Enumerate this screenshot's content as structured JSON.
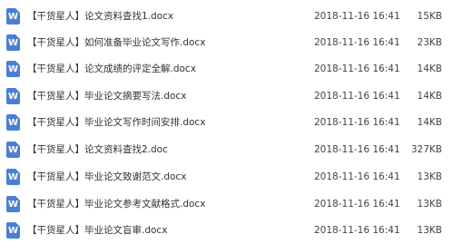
{
  "colors": {
    "word_icon": "#4a7fd6",
    "text": "#333333"
  },
  "icon": {
    "name": "word-doc-icon",
    "glyph": "W"
  },
  "files": [
    {
      "name": "【干货星人】论文资料查找1.docx",
      "modified": "2018-11-16 16:41",
      "size": "15KB"
    },
    {
      "name": "【干货星人】如何准备毕业论文写作.docx",
      "modified": "2018-11-16 16:41",
      "size": "23KB"
    },
    {
      "name": "【干货星人】论文成绩的评定全解.docx",
      "modified": "2018-11-16 16:41",
      "size": "14KB"
    },
    {
      "name": "【干货星人】毕业论文摘要写法.docx",
      "modified": "2018-11-16 16:41",
      "size": "14KB"
    },
    {
      "name": "【干货星人】毕业论文写作时间安排.docx",
      "modified": "2018-11-16 16:41",
      "size": "14KB"
    },
    {
      "name": "【干货星人】论文资料查找2.doc",
      "modified": "2018-11-16 16:41",
      "size": "327KB"
    },
    {
      "name": "【干货星人】毕业论文致谢范文.docx",
      "modified": "2018-11-16 16:41",
      "size": "13KB"
    },
    {
      "name": "【干货星人】毕业论文参考文献格式.docx",
      "modified": "2018-11-16 16:41",
      "size": "13KB"
    },
    {
      "name": "【干货星人】毕业论文盲审.docx",
      "modified": "2018-11-16 16:41",
      "size": "13KB"
    }
  ]
}
